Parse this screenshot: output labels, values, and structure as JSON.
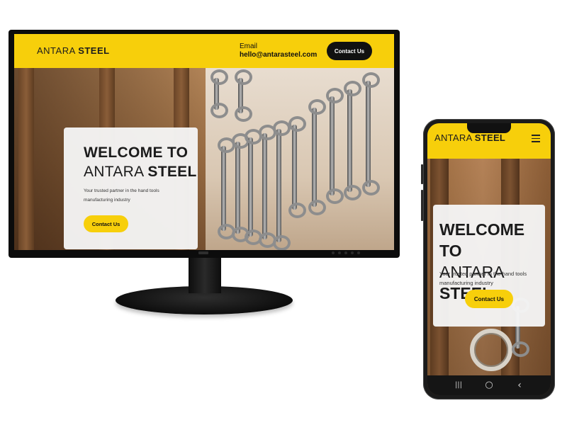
{
  "brand": {
    "light": "ANTARA",
    "bold": "STEEL"
  },
  "desktop": {
    "email_label": "Email",
    "email_value": "hello@antarasteel.com",
    "header_button": "Contact Us",
    "hero": {
      "title_line1": "WELCOME TO",
      "title_line2_light": "ANTARA",
      "title_line2_bold": "STEEL",
      "subtitle": "Your trusted partner in the hand tools manufacturing industry",
      "cta": "Contact Us"
    }
  },
  "mobile": {
    "hero": {
      "title_line1": "WELCOME TO",
      "title_line2_light": "ANTARA",
      "title_line2_bold": "STEEL",
      "subtitle": "Your trusted partner in the hand tools manufacturing industry",
      "cta": "Contact Us"
    },
    "navbar": {
      "recents": "|||",
      "home": "○",
      "back": "‹"
    }
  },
  "colors": {
    "accent": "#f7cf0b",
    "dark": "#111111",
    "card": "#f5f5f5"
  },
  "icons": [
    "hamburger-menu-icon",
    "recents-icon",
    "home-icon",
    "back-icon"
  ]
}
